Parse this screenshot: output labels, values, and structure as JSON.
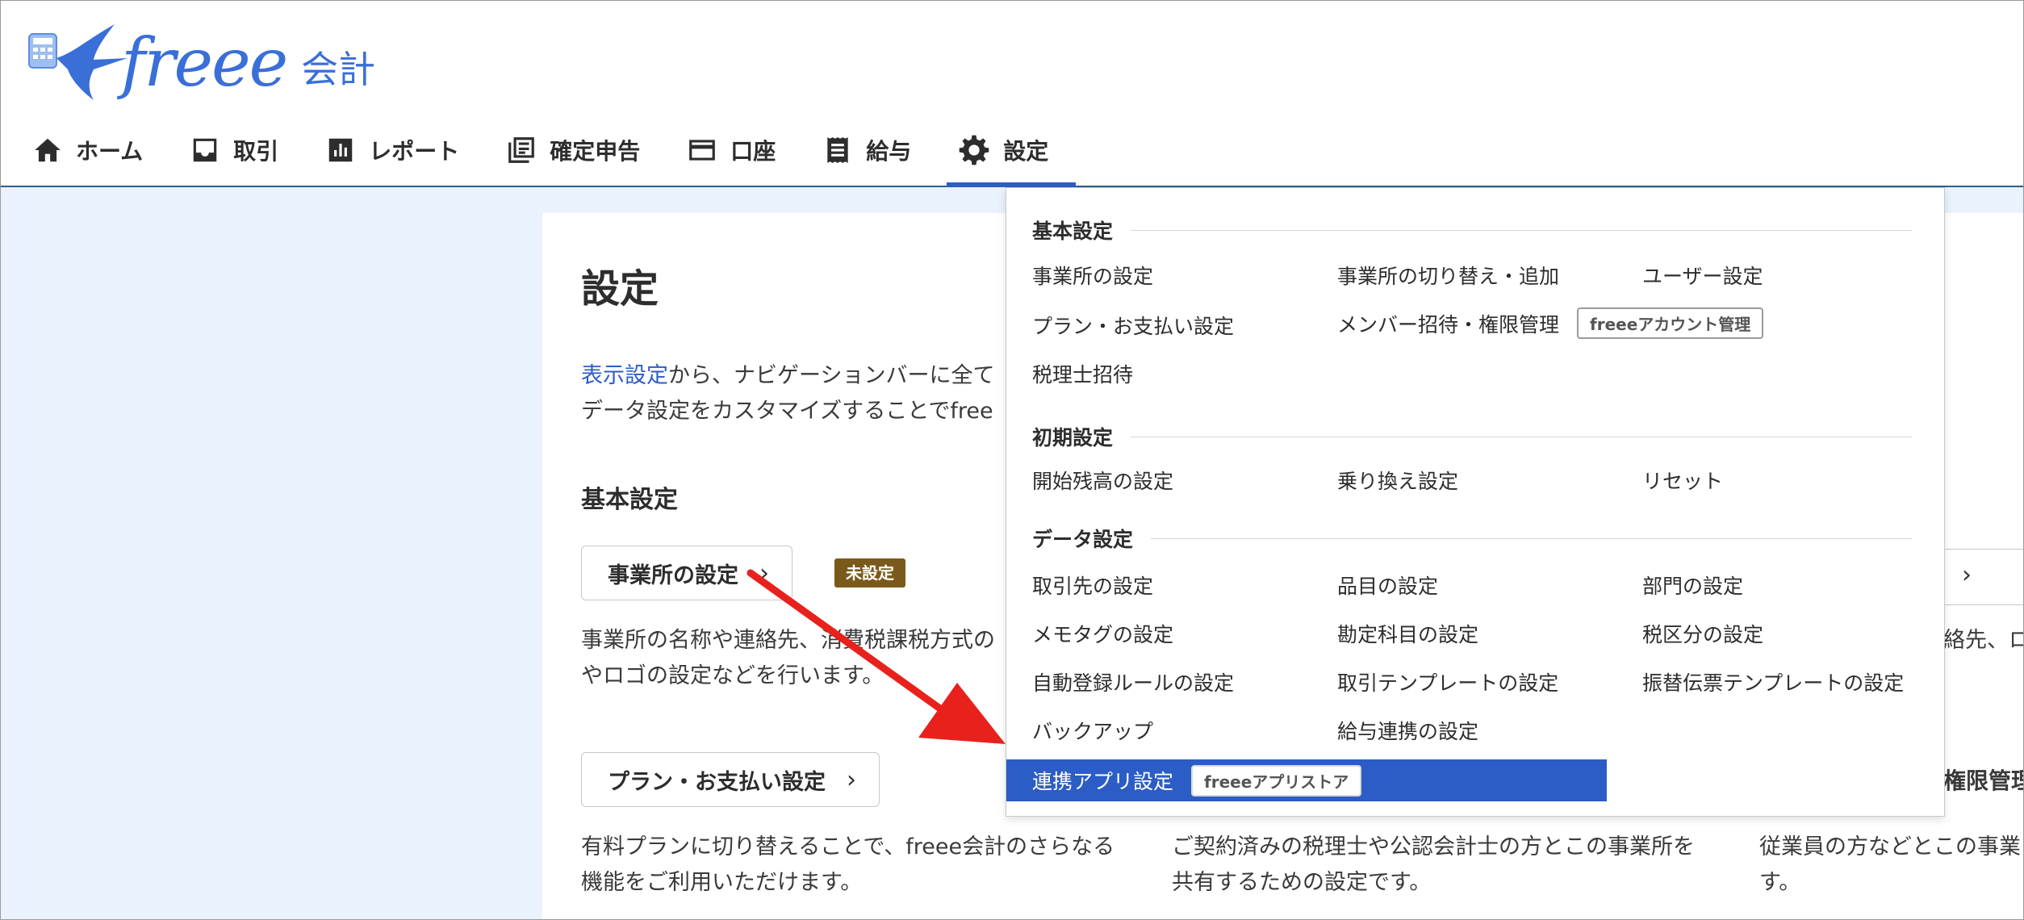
{
  "header": {
    "logo_text": "freee",
    "logo_sub": "会計",
    "nav": [
      {
        "label": "ホーム",
        "icon": "home-icon"
      },
      {
        "label": "取引",
        "icon": "inbox-icon"
      },
      {
        "label": "レポート",
        "icon": "report-chart-icon"
      },
      {
        "label": "確定申告",
        "icon": "tax-return-icon"
      },
      {
        "label": "口座",
        "icon": "card-icon"
      },
      {
        "label": "給与",
        "icon": "payroll-receipt-icon"
      },
      {
        "label": "設定",
        "icon": "gear-icon",
        "active": true
      }
    ]
  },
  "main": {
    "title": "設定",
    "intro_link": "表示設定",
    "intro_line1_rest": "から、ナビゲーションバーに全て",
    "intro_line2": "データ設定をカスタマイズすることでfree",
    "section_title": "基本設定",
    "office_settings_btn": "事業所の設定",
    "unset_badge": "未設定",
    "office_desc_1": "事業所の名称や連絡先、消費税課税方式の",
    "office_desc_2": "やロゴの設定などを行います。",
    "plan_btn": "プラン・お支払い設定",
    "plan_desc_1": "有料プランに切り替えることで、freee会計のさらなる",
    "plan_desc_2": "機能をご利用いただけます。",
    "tax_desc_1": "ご契約済みの税理士や公認会計士の方とこの事業所を",
    "tax_desc_2": "共有するための設定です。",
    "right_desc_1": "絡先、ロ",
    "right_title_2": "権限管理",
    "right_desc_3": "従業員の方などとこの事業",
    "right_desc_4": "す。"
  },
  "dropdown": {
    "sections": [
      {
        "title": "基本設定"
      },
      {
        "title": "初期設定"
      },
      {
        "title": "データ設定"
      }
    ],
    "basic": {
      "office": "事業所の設定",
      "switch": "事業所の切り替え・追加",
      "user": "ユーザー設定",
      "plan": "プラン・お支払い設定",
      "invite": "メンバー招待・権限管理",
      "account_tag": "freeeアカウント管理",
      "accountant": "税理士招待"
    },
    "initial": {
      "opening": "開始残高の設定",
      "migration": "乗り換え設定",
      "reset": "リセット"
    },
    "data": {
      "partners": "取引先の設定",
      "items": "品目の設定",
      "departments": "部門の設定",
      "memotags": "メモタグの設定",
      "accounts": "勘定科目の設定",
      "tax_codes": "税区分の設定",
      "auto_rules": "自動登録ルールの設定",
      "deal_templates": "取引テンプレートの設定",
      "transfer_templates": "振替伝票テンプレートの設定",
      "backup": "バックアップ",
      "payroll_link": "給与連携の設定",
      "app_link": "連携アプリ設定",
      "app_store_tag": "freeeアプリストア"
    }
  },
  "colors": {
    "brand_blue": "#3a6fd8",
    "active_blue": "#2c5cc5",
    "page_bg": "#eaf2fe",
    "unset_badge": "#7a5a1a",
    "arrow_red": "#e8211c"
  }
}
